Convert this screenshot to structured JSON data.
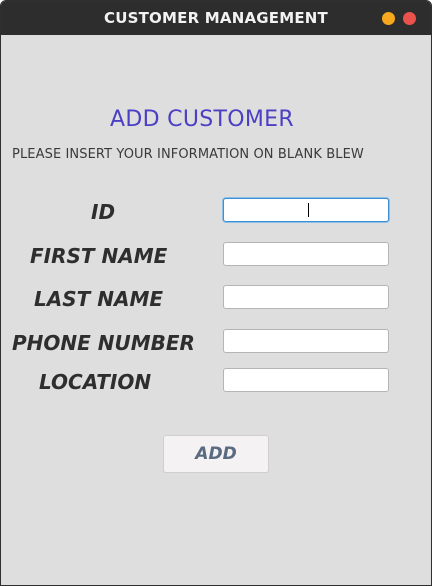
{
  "window": {
    "title": "CUSTOMER MANAGEMENT"
  },
  "form": {
    "heading": "ADD CUSTOMER",
    "subheading": "PLEASE INSERT YOUR INFORMATION ON BLANK BLEW",
    "fields": [
      {
        "label": "ID",
        "value": "",
        "focused": true
      },
      {
        "label": "FIRST NAME",
        "value": ""
      },
      {
        "label": "LAST NAME",
        "value": ""
      },
      {
        "label": "PHONE NUMBER",
        "value": ""
      },
      {
        "label": "LOCATION",
        "value": ""
      }
    ],
    "submit_label": "ADD"
  },
  "colors": {
    "titlebar": "#2d2d2d",
    "heading": "#4b3fc4",
    "minimize": "#f6a81e",
    "close": "#e9534b",
    "focus_ring": "#3d8fd1"
  },
  "icons": {
    "minimize": "minimize-icon",
    "close": "close-icon"
  }
}
